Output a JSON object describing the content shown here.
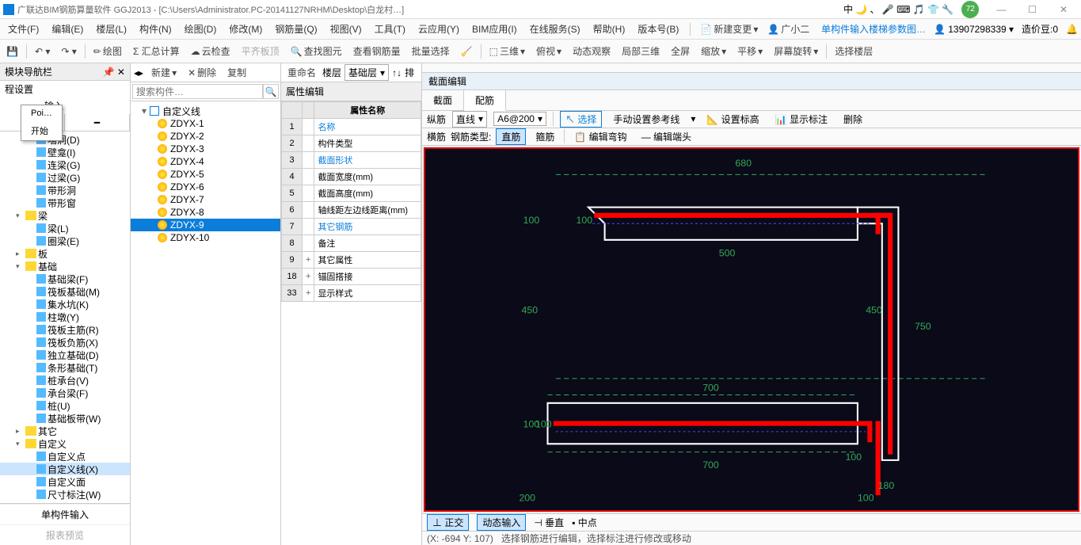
{
  "title": "广联达BIM钢筋算量软件 GGJ2013 - [C:\\Users\\Administrator.PC-20141127NRHM\\Desktop\\白龙村…]",
  "ext_glyphs": "中 🌙 、 🎤 ⌨ 🎵 👕 🔧",
  "bubble": "72",
  "menu": [
    "文件(F)",
    "编辑(E)",
    "楼层(L)",
    "构件(N)",
    "绘图(D)",
    "修改(M)",
    "钢筋量(Q)",
    "视图(V)",
    "工具(T)",
    "云应用(Y)",
    "BIM应用(I)",
    "在线服务(S)",
    "帮助(H)",
    "版本号(B)"
  ],
  "menu_right": {
    "new": "新建变更",
    "user": "广小二",
    "note": "单构件输入楼梯参数图…",
    "phone": "13907298339",
    "beans": "造价豆:0"
  },
  "toolbar1": {
    "draw": "绘图",
    "sum": "Σ 汇总计算",
    "cloud": "云检查",
    "flat": "平齐板顶",
    "find": "查找图元",
    "rebar": "查看钢筋量",
    "batch": "批量选择",
    "threed": "三维",
    "over": "俯视",
    "dyn": "动态观察",
    "local": "局部三维",
    "full": "全屏",
    "zoom": "缩放",
    "pan": "平移",
    "rot": "屏幕旋转",
    "floor": "选择楼层"
  },
  "nav_title": "模块导航栏",
  "nav_sub": "程设置",
  "nav_input": "输入",
  "popup": [
    "Poi…",
    "开始"
  ],
  "tree": [
    {
      "l": 2,
      "t": "墙洞(D)"
    },
    {
      "l": 2,
      "t": "壁龛(I)"
    },
    {
      "l": 2,
      "t": "连梁(G)"
    },
    {
      "l": 2,
      "t": "过梁(G)"
    },
    {
      "l": 2,
      "t": "带形洞"
    },
    {
      "l": 2,
      "t": "带形窗"
    },
    {
      "l": 1,
      "t": "梁",
      "f": 1,
      "o": 1
    },
    {
      "l": 2,
      "t": "梁(L)"
    },
    {
      "l": 2,
      "t": "圈梁(E)"
    },
    {
      "l": 1,
      "t": "板",
      "f": 1
    },
    {
      "l": 1,
      "t": "基础",
      "f": 1,
      "o": 1
    },
    {
      "l": 2,
      "t": "基础梁(F)"
    },
    {
      "l": 2,
      "t": "筏板基础(M)"
    },
    {
      "l": 2,
      "t": "集水坑(K)"
    },
    {
      "l": 2,
      "t": "柱墩(Y)"
    },
    {
      "l": 2,
      "t": "筏板主筋(R)"
    },
    {
      "l": 2,
      "t": "筏板负筋(X)"
    },
    {
      "l": 2,
      "t": "独立基础(D)"
    },
    {
      "l": 2,
      "t": "条形基础(T)"
    },
    {
      "l": 2,
      "t": "桩承台(V)"
    },
    {
      "l": 2,
      "t": "承台梁(F)"
    },
    {
      "l": 2,
      "t": "桩(U)"
    },
    {
      "l": 2,
      "t": "基础板带(W)"
    },
    {
      "l": 1,
      "t": "其它",
      "f": 1
    },
    {
      "l": 1,
      "t": "自定义",
      "f": 1,
      "o": 1
    },
    {
      "l": 2,
      "t": "自定义点"
    },
    {
      "l": 2,
      "t": "自定义线(X)",
      "sel": 1
    },
    {
      "l": 2,
      "t": "自定义面"
    },
    {
      "l": 2,
      "t": "尺寸标注(W)"
    }
  ],
  "bottom": [
    "单构件输入",
    "报表预览"
  ],
  "mid_tb": {
    "new": "新建",
    "del": "删除",
    "copy": "复制",
    "ren": "重命名",
    "floor": "楼层",
    "base": "基础层",
    "sort": "排"
  },
  "search_ph": "搜索构件…",
  "components": {
    "root": "自定义线",
    "items": [
      "ZDYX-1",
      "ZDYX-2",
      "ZDYX-3",
      "ZDYX-4",
      "ZDYX-5",
      "ZDYX-6",
      "ZDYX-7",
      "ZDYX-8",
      "ZDYX-9",
      "ZDYX-10"
    ],
    "sel": 8
  },
  "prop": {
    "title": "属性编辑",
    "col": "属性名称",
    "rows": [
      {
        "n": "1",
        "name": "名称",
        "b": 1
      },
      {
        "n": "2",
        "name": "构件类型"
      },
      {
        "n": "3",
        "name": "截面形状",
        "b": 1
      },
      {
        "n": "4",
        "name": "截面宽度(mm)"
      },
      {
        "n": "5",
        "name": "截面高度(mm)"
      },
      {
        "n": "6",
        "name": "轴线距左边线距离(mm)"
      },
      {
        "n": "7",
        "name": "其它钢筋",
        "b": 1
      },
      {
        "n": "8",
        "name": "备注"
      },
      {
        "n": "9",
        "name": "其它属性",
        "e": 1
      },
      {
        "n": "18",
        "name": "锚固搭接",
        "e": 1
      },
      {
        "n": "33",
        "name": "显示样式",
        "e": 1
      }
    ]
  },
  "section": {
    "title": "截面编辑",
    "tabs": [
      "截面",
      "配筋"
    ],
    "active": 1,
    "row1": {
      "vert": "纵筋",
      "line": "直线",
      "spec": "A6@200",
      "select": "选择",
      "manual": "手动设置参考线",
      "elev": "设置标高",
      "show": "显示标注",
      "del": "删除"
    },
    "row2": {
      "horz": "横筋",
      "type": "钢筋类型:",
      "straight": "直筋",
      "stirrup": "箍筋",
      "hook": "编辑弯钩",
      "end": "编辑端头"
    }
  },
  "dims": {
    "d680": "680",
    "d100a": "100",
    "d100b": "100",
    "d500": "500",
    "d450a": "450",
    "d450b": "450",
    "d750": "750",
    "d700a": "700",
    "d700b": "700",
    "d100c": "100",
    "d100d": "100",
    "d100e": "100",
    "d180": "180",
    "d200": "200",
    "d100f": "100"
  },
  "status": {
    "ortho": "正交",
    "dynin": "动态输入",
    "perp": "垂直",
    "mid": "中点",
    "coord": "(X: -694 Y: 107)",
    "hint": "选择钢筋进行编辑，选择标注进行修改或移动"
  }
}
